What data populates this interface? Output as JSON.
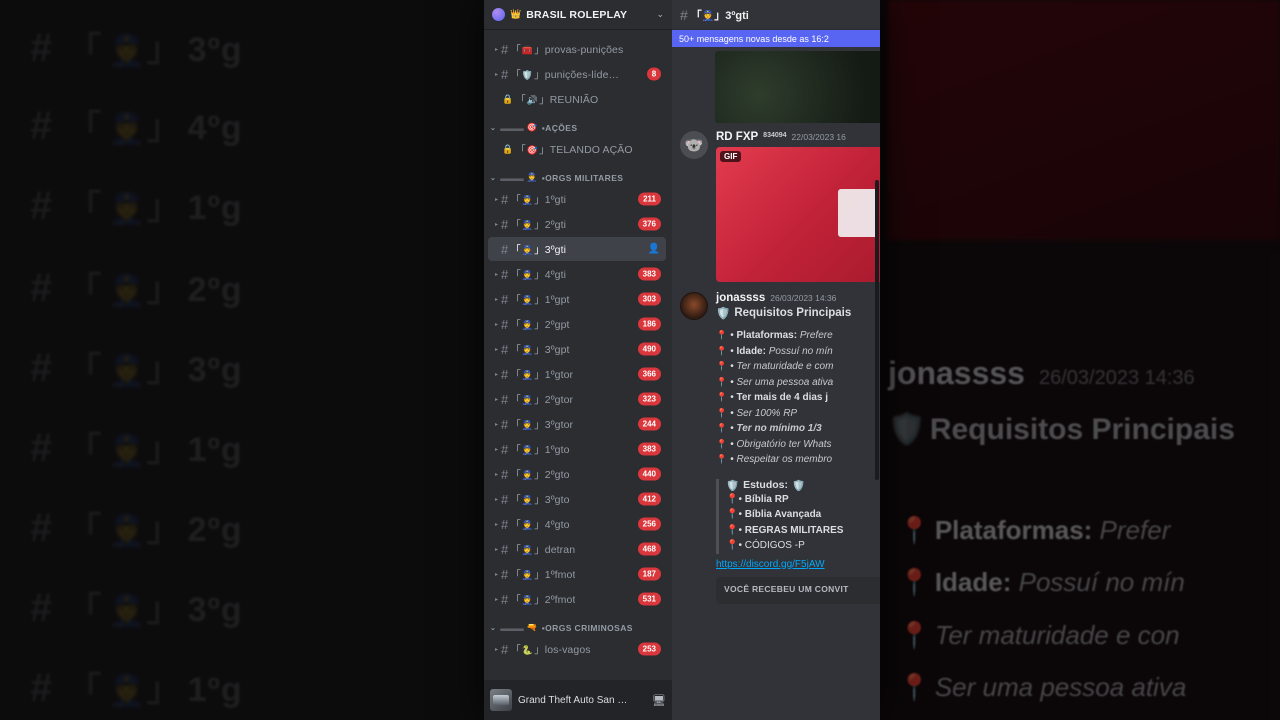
{
  "window": {
    "background_color": "#000000",
    "app_background": "#313338"
  },
  "sidebar": {
    "server_name": "BRASIL ROLEPLAY",
    "server_icon": "server-orb",
    "crown_icon": "👑",
    "chevron": "⌄",
    "channels_top": [
      {
        "arrow": "▸",
        "hash": "#",
        "bracket": "「",
        "emoji": "🧰",
        "bracket2": "」",
        "label": "provas-punições",
        "badge": ""
      },
      {
        "arrow": "▸",
        "hash": "#",
        "bracket": "「",
        "emoji": "🛡️",
        "bracket2": "」",
        "label": "punições-líde…",
        "badge": "8"
      },
      {
        "arrow": "",
        "hash": "🔒",
        "bracket": "「",
        "emoji": "🔊",
        "bracket2": "」",
        "label": "REUNIÃO",
        "badge": ""
      }
    ],
    "category_acoes": {
      "caret": "⌄",
      "dashes": "▬▬▬",
      "emoji": "🎯",
      "label": "▪AÇÕES"
    },
    "channels_acoes": [
      {
        "arrow": "",
        "hash": "🔒",
        "bracket": "「",
        "emoji": "🎯",
        "bracket2": "」",
        "label": "TELANDO AÇÃO",
        "badge": ""
      }
    ],
    "category_orgs_militares": {
      "caret": "⌄",
      "dashes": "▬▬▬",
      "emoji": "👮",
      "label": "▪ORGS MILITARES"
    },
    "channels_militares": [
      {
        "arrow": "▸",
        "hash": "#",
        "bracket": "「",
        "emoji": "👮",
        "bracket2": "」",
        "label": "1ºgti",
        "badge": "211"
      },
      {
        "arrow": "▸",
        "hash": "#",
        "bracket": "「",
        "emoji": "👮",
        "bracket2": "」",
        "label": "2ºgti",
        "badge": "376"
      },
      {
        "arrow": "",
        "hash": "#",
        "bracket": "「",
        "emoji": "👮",
        "bracket2": "」",
        "label": "3ºgti",
        "badge": "",
        "active": true,
        "member_icon": "👤"
      },
      {
        "arrow": "▸",
        "hash": "#",
        "bracket": "「",
        "emoji": "👮",
        "bracket2": "」",
        "label": "4ºgti",
        "badge": "383"
      },
      {
        "arrow": "▸",
        "hash": "#",
        "bracket": "「",
        "emoji": "👮",
        "bracket2": "」",
        "label": "1ºgpt",
        "badge": "303"
      },
      {
        "arrow": "▸",
        "hash": "#",
        "bracket": "「",
        "emoji": "👮",
        "bracket2": "」",
        "label": "2ºgpt",
        "badge": "186"
      },
      {
        "arrow": "▸",
        "hash": "#",
        "bracket": "「",
        "emoji": "👮",
        "bracket2": "」",
        "label": "3ºgpt",
        "badge": "490"
      },
      {
        "arrow": "▸",
        "hash": "#",
        "bracket": "「",
        "emoji": "👮",
        "bracket2": "」",
        "label": "1ºgtor",
        "badge": "366"
      },
      {
        "arrow": "▸",
        "hash": "#",
        "bracket": "「",
        "emoji": "👮",
        "bracket2": "」",
        "label": "2ºgtor",
        "badge": "323"
      },
      {
        "arrow": "▸",
        "hash": "#",
        "bracket": "「",
        "emoji": "👮",
        "bracket2": "」",
        "label": "3ºgtor",
        "badge": "244"
      },
      {
        "arrow": "▸",
        "hash": "#",
        "bracket": "「",
        "emoji": "👮",
        "bracket2": "」",
        "label": "1ºgto",
        "badge": "383"
      },
      {
        "arrow": "▸",
        "hash": "#",
        "bracket": "「",
        "emoji": "👮",
        "bracket2": "」",
        "label": "2ºgto",
        "badge": "440"
      },
      {
        "arrow": "▸",
        "hash": "#",
        "bracket": "「",
        "emoji": "👮",
        "bracket2": "」",
        "label": "3ºgto",
        "badge": "412"
      },
      {
        "arrow": "▸",
        "hash": "#",
        "bracket": "「",
        "emoji": "👮",
        "bracket2": "」",
        "label": "4ºgto",
        "badge": "256"
      },
      {
        "arrow": "▸",
        "hash": "#",
        "bracket": "「",
        "emoji": "👮",
        "bracket2": "」",
        "label": "detran",
        "badge": "468"
      },
      {
        "arrow": "▸",
        "hash": "#",
        "bracket": "「",
        "emoji": "👮",
        "bracket2": "」",
        "label": "1ºfmot",
        "badge": "187"
      },
      {
        "arrow": "▸",
        "hash": "#",
        "bracket": "「",
        "emoji": "👮",
        "bracket2": "」",
        "label": "2ºfmot",
        "badge": "531"
      }
    ],
    "category_orgs_criminosas": {
      "caret": "⌄",
      "dashes": "▬▬▬",
      "emoji": "🔫",
      "label": "▪ORGS CRIMINOSAS"
    },
    "channels_criminosas": [
      {
        "arrow": "▸",
        "hash": "#",
        "bracket": "「",
        "emoji": "🐍",
        "bracket2": "」",
        "label": "los-vagos",
        "badge": "253"
      }
    ],
    "user_area": {
      "game_name": "Grand Theft Auto San …",
      "screen_icon": "🖥"
    }
  },
  "chat": {
    "header": {
      "hash": "#",
      "bracket": "「",
      "emoji": "👮",
      "bracket2": "」",
      "title": "3ºgti"
    },
    "new_messages_banner": "50+ mensagens novas desde as 16:2",
    "messages": [
      {
        "type": "image-only",
        "name": "top-embed-image"
      },
      {
        "author": "RD FXP",
        "tag": "834094",
        "timestamp": "22/03/2023 16",
        "avatar_emoji": "🐨",
        "attachment": "GIF",
        "gif_badge": "GIF"
      },
      {
        "author": "jonassss",
        "timestamp": "26/03/2023 14:36",
        "avatar_emoji": "",
        "rich_title_emoji": "🛡️",
        "rich_title": "Requisitos Principais",
        "requirements": [
          {
            "pin": "📍",
            "bold": "Plataformas:",
            "rest": " Prefere",
            "italic": true
          },
          {
            "pin": "📍",
            "bold": "Idade:",
            "rest": " Possuí no mín",
            "italic": true
          },
          {
            "pin": "📍",
            "bold": "",
            "rest": "Ter maturidade e com",
            "italic": true
          },
          {
            "pin": "📍",
            "bold": "",
            "rest": "Ser uma pessoa ativa",
            "italic": true
          },
          {
            "pin": "📍",
            "bold": "Ter mais de 4 dias j",
            "rest": "",
            "italic": false
          },
          {
            "pin": "📍",
            "bold": "",
            "rest": "Ser 100% RP",
            "italic": true
          },
          {
            "pin": "📍",
            "bold": "Ter no mínimo 1/3",
            "rest": "",
            "italic": true
          },
          {
            "pin": "📍",
            "bold": "",
            "rest": "Obrigatório ter Whats",
            "italic": true
          },
          {
            "pin": "📍",
            "bold": "",
            "rest": "Respeitar os membro",
            "italic": true
          }
        ],
        "quote": {
          "heading_emoji_left": "🛡️",
          "heading": "Estudos:",
          "heading_emoji_right": "🛡️",
          "lines": [
            {
              "pin": "📍",
              "text": "Bíblia RP",
              "bold": true
            },
            {
              "pin": "📍",
              "text": "Bíblia Avançada",
              "bold": true
            },
            {
              "pin": "📍",
              "text": "REGRAS MILITARES",
              "bold": true
            },
            {
              "pin": "📍",
              "text": "CÓDIGOS -P",
              "bold": false
            }
          ]
        },
        "link": "https://discord.gg/F5jAW",
        "invite": {
          "heading": "VOCÊ RECEBEU UM CONVIT",
          "subtitle": ""
        }
      }
    ]
  },
  "background_left": {
    "rows": [
      {
        "hash": "#",
        "bracket": "「",
        "emoji": "👮",
        "bracket2": "」",
        "label": "3ºg"
      },
      {
        "hash": "#",
        "bracket": "「",
        "emoji": "👮",
        "bracket2": "」",
        "label": "4ºg"
      },
      {
        "hash": "#",
        "bracket": "「",
        "emoji": "👮",
        "bracket2": "」",
        "label": "1ºg"
      },
      {
        "hash": "#",
        "bracket": "「",
        "emoji": "👮",
        "bracket2": "」",
        "label": "2ºg"
      },
      {
        "hash": "#",
        "bracket": "「",
        "emoji": "👮",
        "bracket2": "」",
        "label": "3ºg"
      },
      {
        "hash": "#",
        "bracket": "「",
        "emoji": "👮",
        "bracket2": "」",
        "label": "1ºg"
      },
      {
        "hash": "#",
        "bracket": "「",
        "emoji": "👮",
        "bracket2": "」",
        "label": "2ºg"
      },
      {
        "hash": "#",
        "bracket": "「",
        "emoji": "👮",
        "bracket2": "」",
        "label": "3ºg"
      },
      {
        "hash": "#",
        "bracket": "「",
        "emoji": "👮",
        "bracket2": "」",
        "label": "1ºg"
      }
    ]
  },
  "background_right": {
    "author": "jonassss",
    "timestamp": "26/03/2023 14:36",
    "title_emoji": "🛡️",
    "title": "Requisitos Principais",
    "lines": [
      {
        "pin": "📍",
        "bold": "Plataformas:",
        "rest": " Prefer"
      },
      {
        "pin": "📍",
        "bold": "Idade:",
        "rest": " Possuí no mín"
      },
      {
        "pin": "📍",
        "bold": "",
        "rest": "Ter maturidade e con"
      },
      {
        "pin": "📍",
        "bold": "",
        "rest": "Ser uma pessoa ativa"
      }
    ]
  }
}
